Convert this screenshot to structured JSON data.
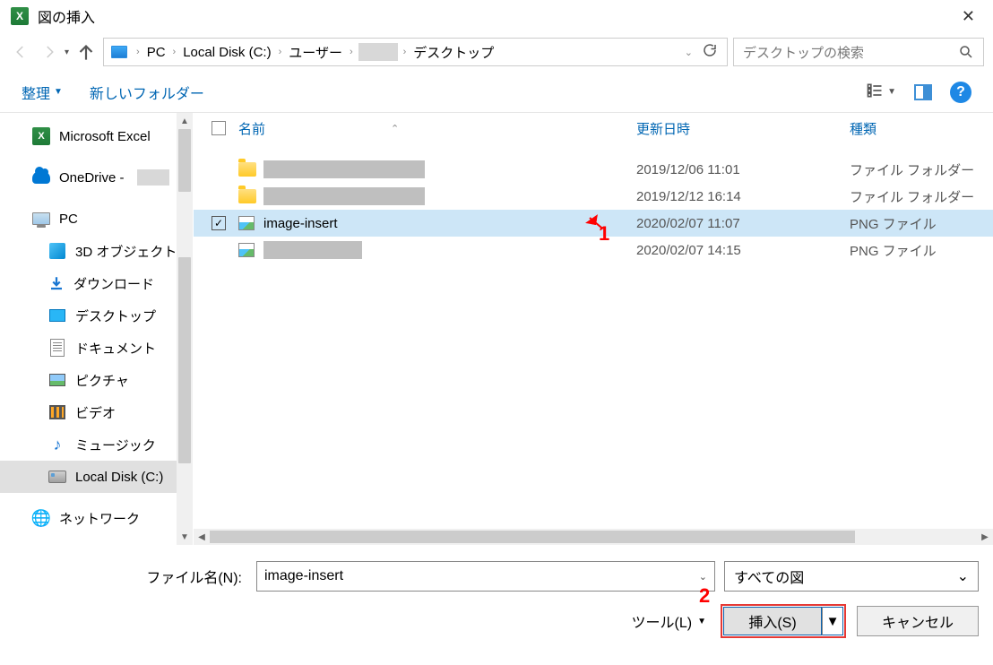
{
  "title": "図の挿入",
  "breadcrumb": {
    "pc": "PC",
    "disk": "Local Disk (C:)",
    "users": "ユーザー",
    "desktop": "デスクトップ"
  },
  "search_placeholder": "デスクトップの検索",
  "toolbar": {
    "organize": "整理",
    "new_folder": "新しいフォルダー"
  },
  "columns": {
    "name": "名前",
    "date": "更新日時",
    "type": "種類"
  },
  "sidebar": {
    "excel": "Microsoft Excel",
    "onedrive": "OneDrive -",
    "pc": "PC",
    "obj3d": "3D オブジェクト",
    "downloads": "ダウンロード",
    "desktop": "デスクトップ",
    "documents": "ドキュメント",
    "pictures": "ピクチャ",
    "videos": "ビデオ",
    "music": "ミュージック",
    "local_disk": "Local Disk (C:)",
    "network": "ネットワーク"
  },
  "rows": {
    "r1": {
      "date": "2019/12/06 11:01",
      "type": "ファイル フォルダー"
    },
    "r2": {
      "date": "2019/12/12 16:14",
      "type": "ファイル フォルダー"
    },
    "r3": {
      "name": "image-insert",
      "date": "2020/02/07 11:07",
      "type": "PNG ファイル"
    },
    "r4": {
      "date": "2020/02/07 14:15",
      "type": "PNG ファイル"
    }
  },
  "footer": {
    "file_label": "ファイル名(N):",
    "file_value": "image-insert",
    "filter": "すべての図",
    "tools": "ツール(L)",
    "insert": "挿入(S)",
    "cancel": "キャンセル"
  },
  "annot": {
    "n1": "1",
    "n2": "2"
  }
}
